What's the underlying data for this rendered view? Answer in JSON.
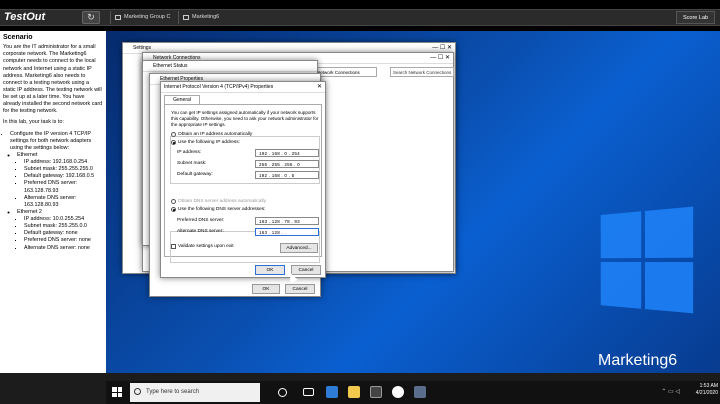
{
  "topbar": {
    "logo": "TestOut",
    "tabs": [
      {
        "label": "Marketing Group C"
      },
      {
        "label": "Marketing6"
      }
    ],
    "score_label": "Score Lab"
  },
  "scenario": {
    "heading": "Scenario",
    "intro": "You are the IT administrator for a small corporate network. The Marketing6 computer needs to connect to the local network and Internet using a static IP address. Marketing6 also needs to connect to a testing network using a static IP address. The testing network will be set up at a later time. You have already installed the second network card for the testing network.",
    "task": "In this lab, your task is to:",
    "items": [
      {
        "text": "Configure the IP version 4 TCP/IP settings for both network adapters using the settings below:",
        "sub": [
          {
            "text": "Ethernet",
            "sub": [
              "IP address: 192.168.0.254",
              "Subnet mask: 255.255.255.0",
              "Default gateway: 192.168.0.5",
              "Preferred DNS server: 163.128.78.93",
              "Alternate DNS server: 163.128.80.93"
            ]
          },
          {
            "text": "Ethernet 2",
            "sub": [
              "IP address: 10.0.255.254",
              "Subnet mask: 255.255.0.0",
              "Default gateway: none",
              "Preferred DNS server: none",
              "Alternate DNS server: none"
            ]
          }
        ]
      }
    ]
  },
  "windows": {
    "settings_title": "Settings",
    "netconn_title": "Network Connections",
    "address_bar": "Network Connections",
    "search_placeholder": "Search Network Connections",
    "status_title": "Ethernet Status",
    "eprops_title": "Ethernet Properties",
    "eprops_ok": "OK",
    "eprops_cancel": "Cancel",
    "ipv4": {
      "title": "Internet Protocol Version 4 (TCP/IPv4) Properties",
      "tab": "General",
      "description": "You can get IP settings assigned automatically if your network supports this capability. Otherwise, you need to ask your network administrator for the appropriate IP settings.",
      "auto_ip": "Obtain an IP address automatically",
      "use_ip": "Use the following IP address:",
      "ip_label": "IP address:",
      "ip_value": "192 . 168 . 0 . 254",
      "mask_label": "Subnet mask:",
      "mask_value": "255 . 255 . 255 . 0",
      "gw_label": "Default gateway:",
      "gw_value": "192 . 168 . 0 . 5",
      "auto_dns": "Obtain DNS server address automatically",
      "use_dns": "Use the following DNS server addresses:",
      "pdns_label": "Preferred DNS server:",
      "pdns_value": "163 . 128 . 78 . 93",
      "adns_label": "Alternate DNS server:",
      "adns_value": "163 . 128 .   .  ",
      "validate": "Validate settings upon exit",
      "advanced": "Advanced...",
      "ok": "OK",
      "cancel": "Cancel"
    }
  },
  "desktop": {
    "hostname": "Marketing6"
  },
  "taskbar": {
    "search": "Type here to search",
    "time": "1:53 AM",
    "date": "4/21/2020"
  },
  "colors": {
    "desktop": "#0a4fb0",
    "accent": "#2b6fd6"
  }
}
